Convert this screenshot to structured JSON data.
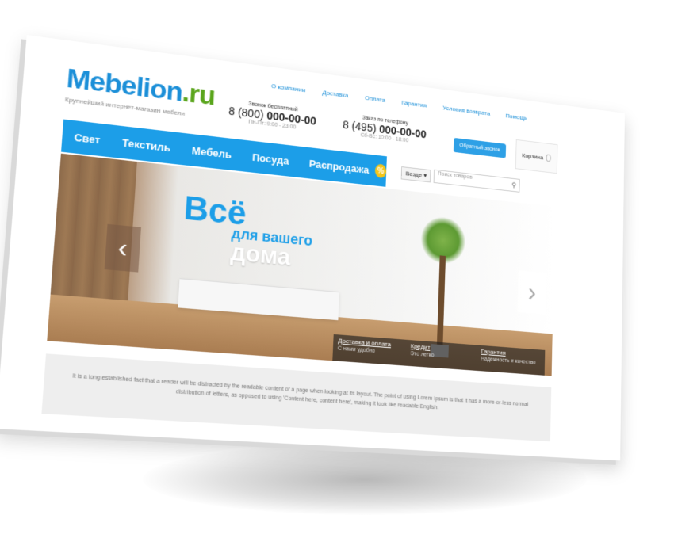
{
  "site": {
    "logo_main": "Mebelion",
    "logo_tld": ".ru",
    "tagline": "Крупнейший интернет-магазин мебели"
  },
  "topnav": [
    "О компании",
    "Доставка",
    "Оплата",
    "Гарантия",
    "Условия возврата",
    "Помощь"
  ],
  "phones": [
    {
      "caption": "Звонок бесплатный",
      "prefix": "8 (800)",
      "number": "000-00-00",
      "hours": "Пн-Пт: 9:00 - 23:00"
    },
    {
      "caption": "Заказ по телефону",
      "prefix": "8 (495)",
      "number": "000-00-00",
      "hours": "Сб-Вс: 10:00 - 18:00"
    }
  ],
  "callback_label": "Обратный звонок",
  "cart": {
    "label": "Корзина",
    "count": "0"
  },
  "mainnav": [
    "Свет",
    "Текстиль",
    "Мебель",
    "Посуда",
    "Распродажа"
  ],
  "sale_badge": "%",
  "search": {
    "scope": "Везде",
    "placeholder": "Поиск товаров"
  },
  "banner": {
    "line1": "Всё",
    "line2": "для вашего",
    "line3": "дома",
    "prev_arrow": "‹",
    "next_arrow": "›",
    "info": [
      {
        "title": "Доставка и оплата",
        "sub": "С нами удобно"
      },
      {
        "title": "Кредит",
        "sub": "Это легко"
      },
      {
        "title": "Гарантия",
        "sub": "Надежность и качество"
      }
    ]
  },
  "content_text": "It is a long established fact that a reader will be distracted by the readable content of a page when looking at its layout. The point of using Lorem Ipsum is that it has a more-or-less normal distribution of letters, as opposed to using 'Content here, content here', making it look like readable English.",
  "colors": {
    "brand_blue": "#1c9ee8",
    "brand_green": "#5aa51c",
    "sale_yellow": "#f5c518"
  }
}
